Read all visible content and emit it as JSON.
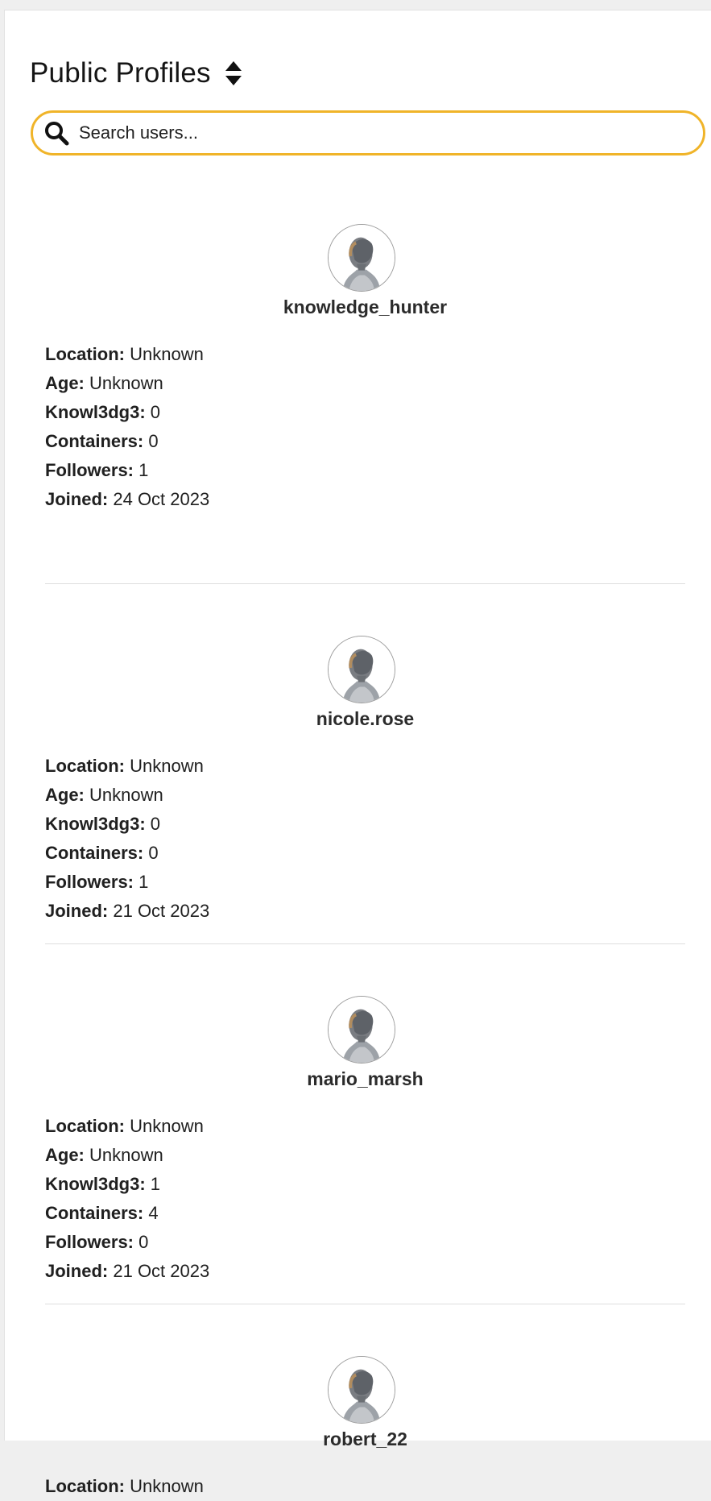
{
  "header": {
    "title": "Public Profiles",
    "sort_icon": "sort-icon"
  },
  "search": {
    "placeholder": "Search users...",
    "icon": "search-icon"
  },
  "profiles": [
    {
      "username": "knowledge_hunter",
      "location_label": "Location:",
      "location": "Unknown",
      "age_label": "Age:",
      "age": "Unknown",
      "knowledge_label": "Knowl3dg3:",
      "knowledge": "0",
      "containers_label": "Containers:",
      "containers": "0",
      "followers_label": "Followers:",
      "followers": "1",
      "joined_label": "Joined:",
      "joined": "24 Oct 2023"
    },
    {
      "username": "nicole.rose",
      "location_label": "Location:",
      "location": "Unknown",
      "age_label": "Age:",
      "age": "Unknown",
      "knowledge_label": "Knowl3dg3:",
      "knowledge": "0",
      "containers_label": "Containers:",
      "containers": "0",
      "followers_label": "Followers:",
      "followers": "1",
      "joined_label": "Joined:",
      "joined": "21 Oct 2023"
    },
    {
      "username": "mario_marsh",
      "location_label": "Location:",
      "location": "Unknown",
      "age_label": "Age:",
      "age": "Unknown",
      "knowledge_label": "Knowl3dg3:",
      "knowledge": "1",
      "containers_label": "Containers:",
      "containers": "4",
      "followers_label": "Followers:",
      "followers": "0",
      "joined_label": "Joined:",
      "joined": "21 Oct 2023"
    },
    {
      "username": "robert_22",
      "location_label": "Location:",
      "location": "Unknown"
    }
  ],
  "colors": {
    "accent": "#f0b429",
    "text": "#1f1f1f",
    "divider": "#dedede"
  }
}
